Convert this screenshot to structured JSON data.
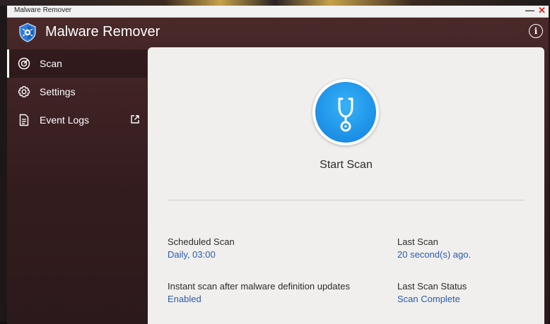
{
  "window": {
    "title": "Malware Remover",
    "minimize_label": "—",
    "close_label": "✕"
  },
  "app": {
    "title": "Malware Remover",
    "info_label": "i"
  },
  "sidebar": {
    "items": [
      {
        "label": "Scan",
        "icon": "scan-icon",
        "active": true
      },
      {
        "label": "Settings",
        "icon": "gear-icon",
        "active": false
      },
      {
        "label": "Event Logs",
        "icon": "document-icon",
        "active": false,
        "external": true
      }
    ]
  },
  "main": {
    "scan_button_label": "Start Scan",
    "scheduled_scan": {
      "label": "Scheduled Scan",
      "value": "Daily, 03:00"
    },
    "last_scan": {
      "label": "Last Scan",
      "value": "20 second(s) ago."
    },
    "instant_scan": {
      "label": "Instant scan after malware definition updates",
      "value": "Enabled"
    },
    "last_scan_status": {
      "label": "Last Scan Status",
      "value": "Scan Complete"
    }
  },
  "colors": {
    "accent_blue": "#1c8fe6",
    "link_blue": "#2a5bb0",
    "sidebar_bg": "#3e2224",
    "close_red": "#e02020"
  }
}
